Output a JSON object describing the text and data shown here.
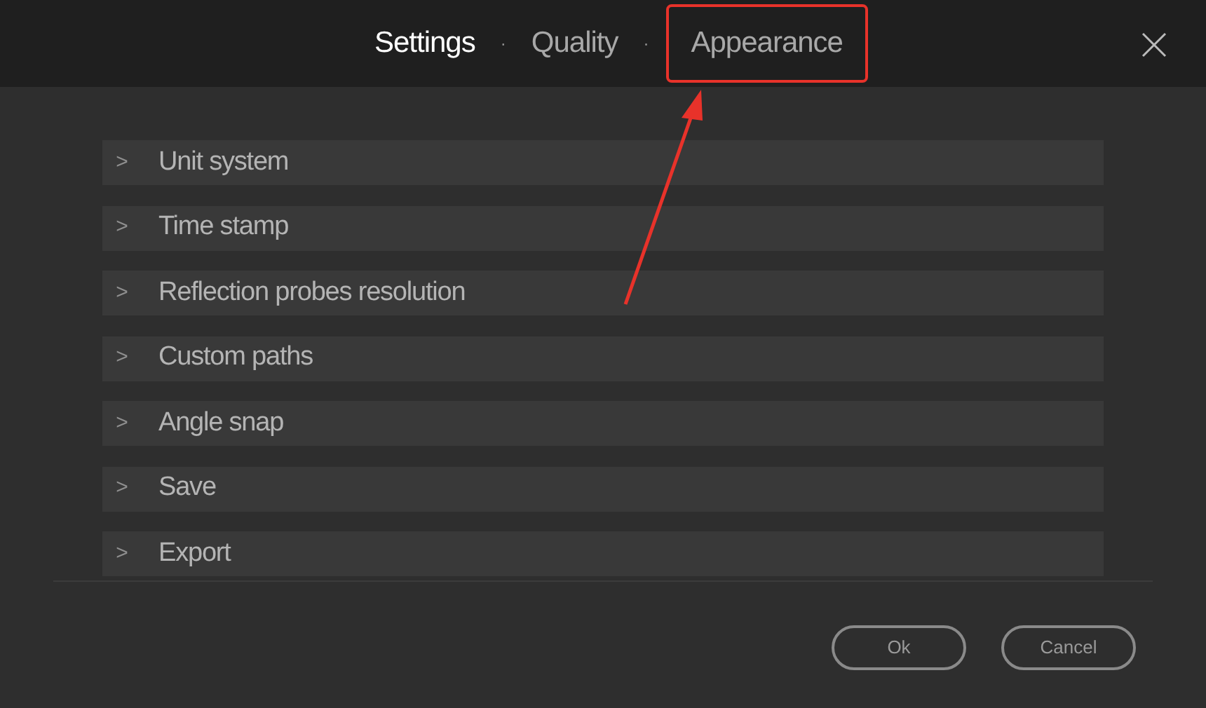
{
  "tabs": [
    {
      "label": "Settings",
      "selected": true,
      "highlighted": false
    },
    {
      "label": "Quality",
      "selected": false,
      "highlighted": false
    },
    {
      "label": "Appearance",
      "selected": false,
      "highlighted": true
    }
  ],
  "tab_separator": "·",
  "sections": [
    {
      "marker": ">",
      "label": "Unit system",
      "expanded": false
    },
    {
      "marker": ">",
      "label": "Time stamp",
      "expanded": false
    },
    {
      "marker": ">",
      "label": "Reflection probes resolution",
      "expanded": false
    },
    {
      "marker": ">",
      "label": "Custom paths",
      "expanded": false
    },
    {
      "marker": ">",
      "label": "Angle snap",
      "expanded": false
    },
    {
      "marker": ">",
      "label": "Save",
      "expanded": false
    },
    {
      "marker": ">",
      "label": "Export",
      "expanded": false
    }
  ],
  "buttons": [
    "Ok",
    "Cancel"
  ]
}
